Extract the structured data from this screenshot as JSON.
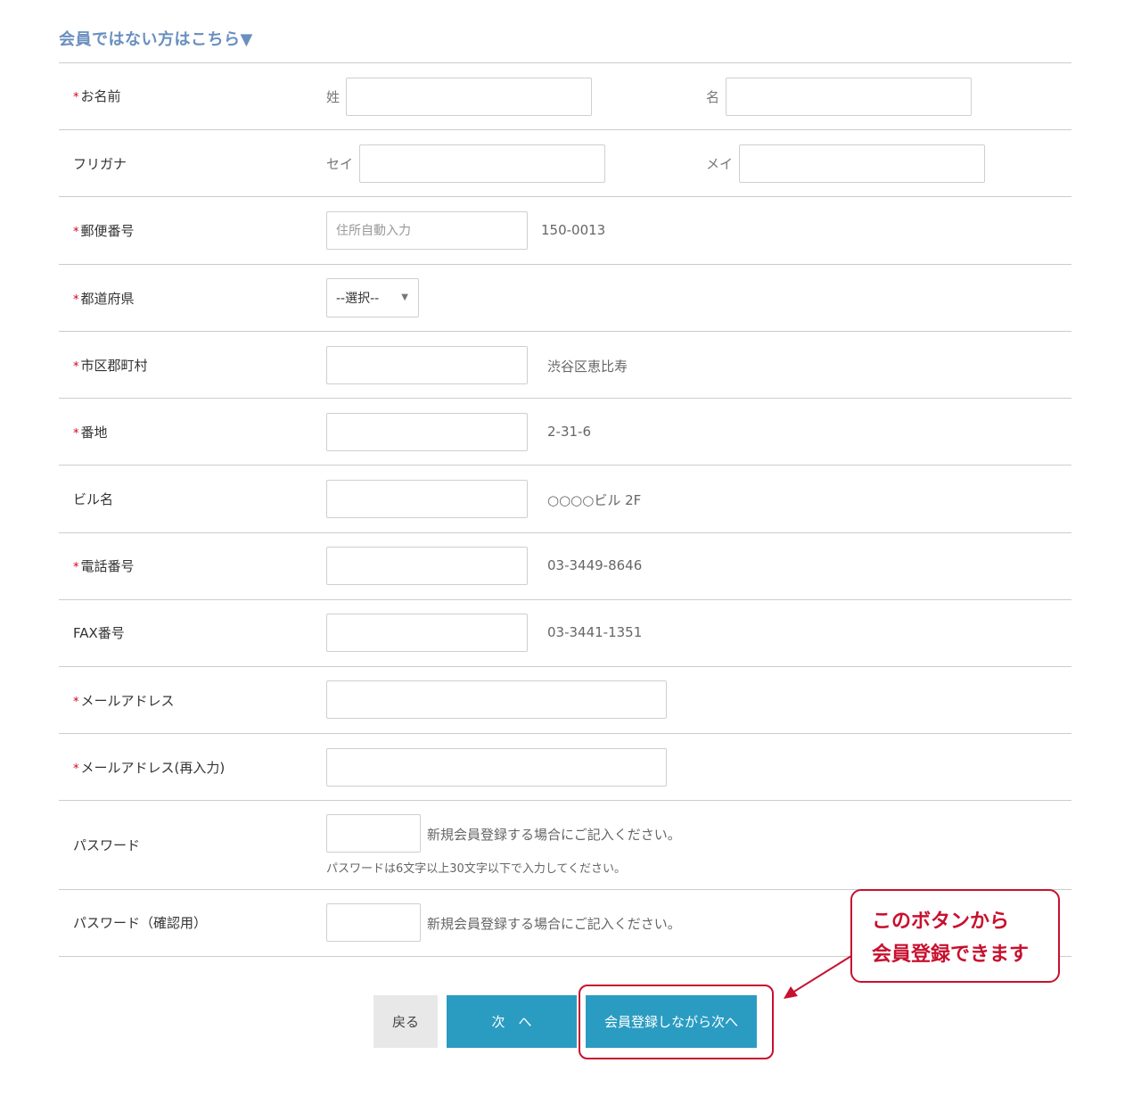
{
  "section_title": "会員ではない方はこちら▼",
  "required_mark": "*",
  "fields": {
    "name": {
      "label": "お名前",
      "last_label": "姓",
      "first_label": "名"
    },
    "furigana": {
      "label": "フリガナ",
      "last_label": "セイ",
      "first_label": "メイ"
    },
    "postal": {
      "label": "郵便番号",
      "placeholder": "住所自動入力",
      "hint": "150-0013"
    },
    "prefecture": {
      "label": "都道府県",
      "selected": "--選択--"
    },
    "city": {
      "label": "市区郡町村",
      "hint": "渋谷区恵比寿"
    },
    "address": {
      "label": "番地",
      "hint": "2-31-6"
    },
    "building": {
      "label": "ビル名",
      "hint": "○○○○ビル 2F"
    },
    "phone": {
      "label": "電話番号",
      "hint": "03-3449-8646"
    },
    "fax": {
      "label": "FAX番号",
      "hint": "03-3441-1351"
    },
    "email": {
      "label": "メールアドレス"
    },
    "email_confirm": {
      "label": "メールアドレス(再入力)"
    },
    "password": {
      "label": "パスワード",
      "hint": "新規会員登録する場合にご記入ください。",
      "note": "パスワードは6文字以上30文字以下で入力してください。"
    },
    "password_confirm": {
      "label": "パスワード（確認用）",
      "hint": "新規会員登録する場合にご記入ください。"
    }
  },
  "buttons": {
    "back": "戻る",
    "next": "次　へ",
    "register_next": "会員登録しながら次へ"
  },
  "callout": {
    "line1": "このボタンから",
    "line2": "会員登録できます"
  },
  "colors": {
    "title": "#6a8fbf",
    "required": "#d0021b",
    "button": "#2a9cc2",
    "annotation": "#c8102e"
  }
}
